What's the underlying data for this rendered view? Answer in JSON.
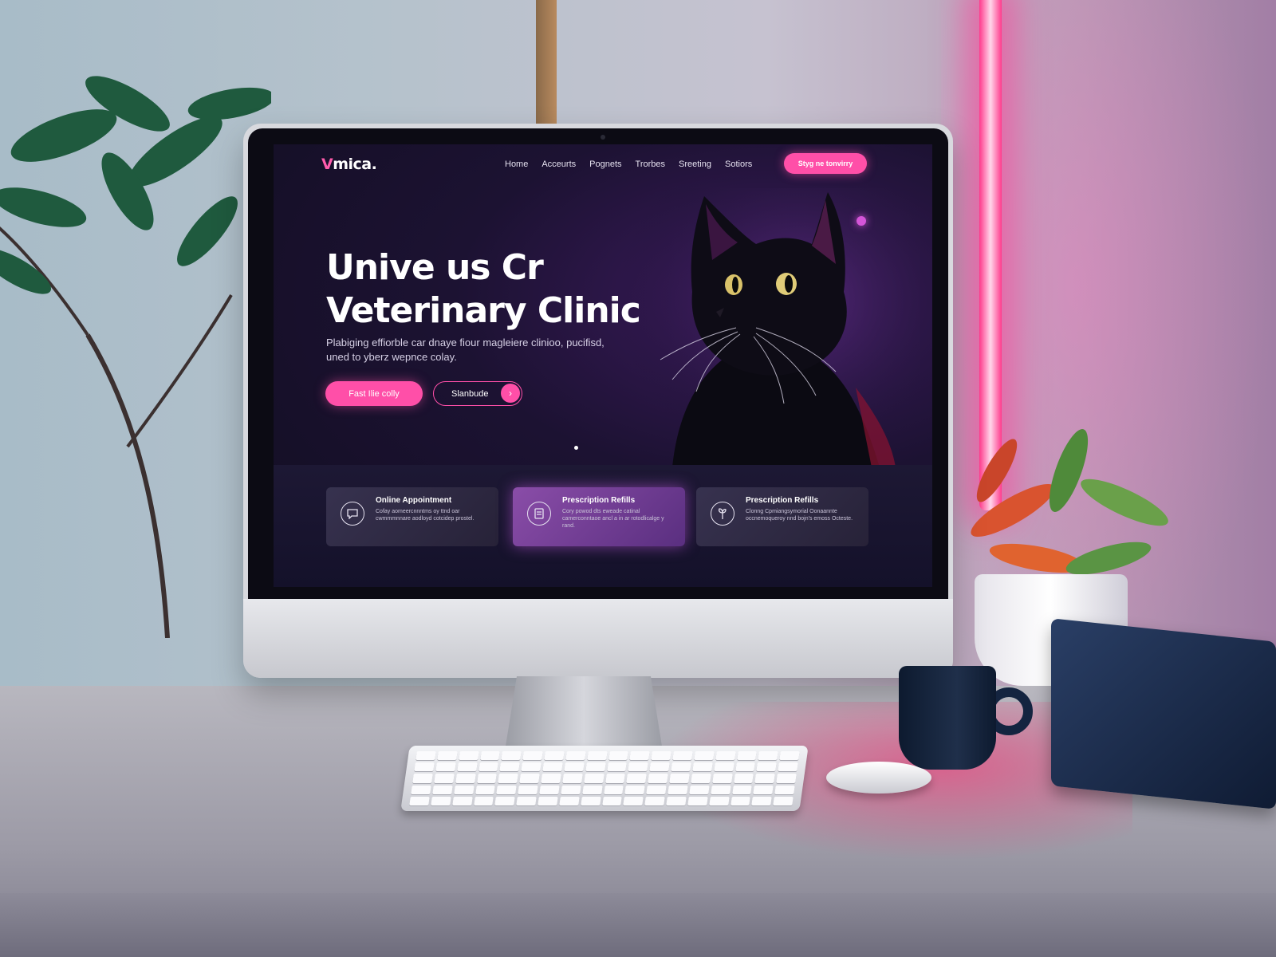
{
  "site": {
    "logo": {
      "mark": "V",
      "name": "mica."
    },
    "nav": {
      "links": [
        "Home",
        "Acceurts",
        "Pognets",
        "Trorbes",
        "Sreeting",
        "Sotiors"
      ],
      "cta_label": "Styg ne tonvirry"
    },
    "hero": {
      "title_line1": "Unive us Cr",
      "title_line2": "Veterinary Clinic",
      "subtitle": "Plabiging effiorble car dnaye fiour magleiere clinioo, pucifisd, uned to yberz wepnce colay.",
      "primary_button": "Fast Ilie colly",
      "secondary_button": "Slanbude"
    },
    "features": [
      {
        "title": "Online Appointment",
        "description": "Cofay aomeercnnntms oy ttnd oar cwmmmnnare aodloyd cotcidep prostel.",
        "icon": "chat-bubble-icon",
        "active": false
      },
      {
        "title": "Prescription Refills",
        "description": "Cory powod dts eweade catinal camerconntaoe ancl a in ar rotodlicalge y rand.",
        "icon": "prescription-icon",
        "active": true
      },
      {
        "title": "Prescription Refills",
        "description": "Clonng Cpmiangsymorial Oonaannte occnemoqueroy nnd bojn's emoss Octeste.",
        "icon": "plant-care-icon",
        "active": false
      }
    ]
  },
  "colors": {
    "accent": "#ff4fa8",
    "screen_bg": "#120e22",
    "card_active": "#8a4da8",
    "neon": "#ff3a8c"
  }
}
